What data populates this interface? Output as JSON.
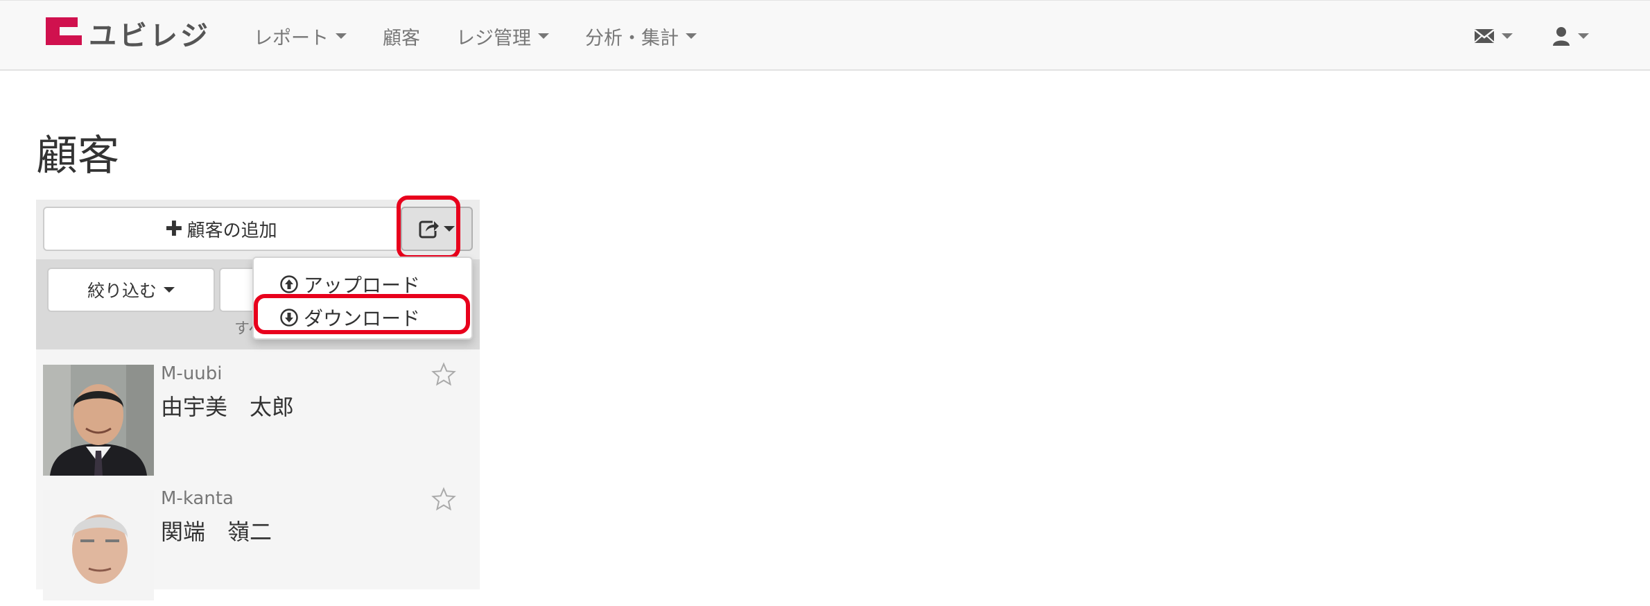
{
  "navbar": {
    "logo_text": "ユビレジ",
    "items": [
      {
        "label": "レポート",
        "has_caret": true
      },
      {
        "label": "顧客",
        "has_caret": false
      },
      {
        "label": "レジ管理",
        "has_caret": true
      },
      {
        "label": "分析・集計",
        "has_caret": true
      }
    ],
    "right_icons": [
      "envelope-icon",
      "user-icon"
    ]
  },
  "page": {
    "title": "顧客"
  },
  "toolbar": {
    "add_label": "顧客の追加",
    "share_icon": "share-icon"
  },
  "filter": {
    "filter_label": "絞り込む",
    "status_text": "すべて"
  },
  "dropdown": {
    "items": [
      {
        "label": "アップロード",
        "icon": "upload-circle-icon"
      },
      {
        "label": "ダウンロード",
        "icon": "download-circle-icon"
      }
    ]
  },
  "customers": [
    {
      "code": "M-uubi",
      "name": "由宇美　太郎",
      "favorite": false
    },
    {
      "code": "M-kanta",
      "name": "関端　嶺二",
      "favorite": false
    }
  ],
  "colors": {
    "brand": "#d0114e",
    "highlight": "#e8001c"
  }
}
